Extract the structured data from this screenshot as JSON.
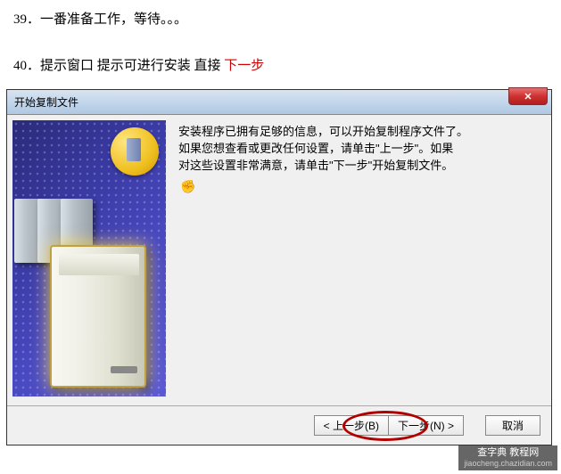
{
  "instructions": {
    "item39": "39．一番准备工作，等待。。。",
    "item40_prefix": "40．提示窗口 提示可进行安装   直接 ",
    "item40_highlight": "下一步"
  },
  "dialog": {
    "title": "开始复制文件",
    "body_line1": "安装程序已拥有足够的信息，可以开始复制程序文件了。",
    "body_line2": "如果您想查看或更改任何设置，请单击\"上一步\"。如果",
    "body_line3": "对这些设置非常满意，请单击\"下一步\"开始复制文件。",
    "buttons": {
      "back": "< 上一步(B)",
      "next": "下一步(N) >",
      "cancel": "取消"
    }
  },
  "watermark": {
    "main": "查字典 教程网",
    "sub": "jiaocheng.chazidian.com"
  }
}
